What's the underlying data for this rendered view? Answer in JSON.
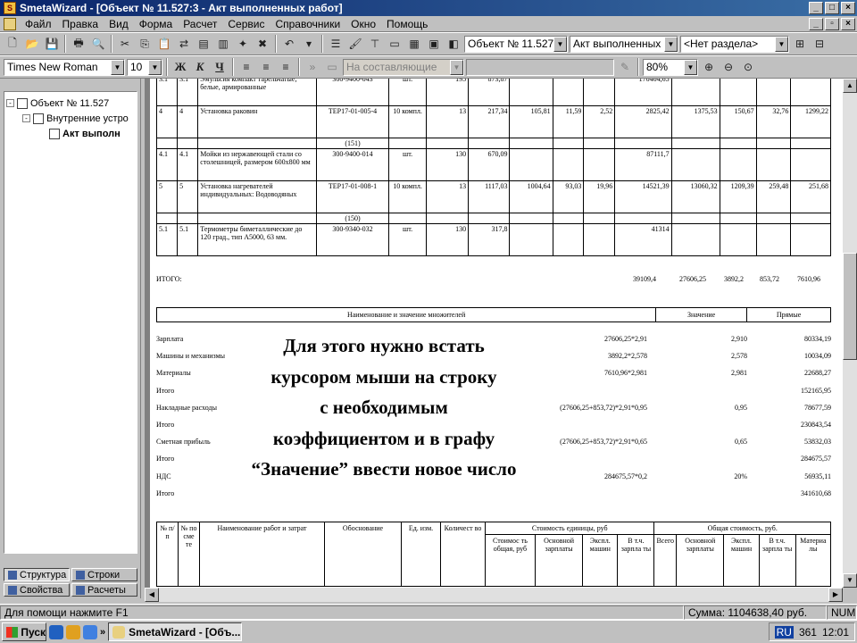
{
  "window": {
    "title": "SmetaWizard - [Объект № 11.527:3 - Акт выполненных работ]",
    "app_icon": "sw-icon"
  },
  "menu": [
    "Файл",
    "Правка",
    "Вид",
    "Форма",
    "Расчет",
    "Сервис",
    "Справочники",
    "Окно",
    "Помощь"
  ],
  "toolbar": {
    "object_combo": "Объект № 11.527",
    "form_combo": "Акт выполненных ра",
    "section_combo": "<Нет раздела>"
  },
  "format_bar": {
    "font": "Times New Roman",
    "size": "10",
    "bold": "Ж",
    "italic": "К",
    "underline": "Ч",
    "mode_combo": "На составляющие",
    "zoom": "80%"
  },
  "tree": [
    {
      "label": "Объект № 11.527",
      "expander": "-"
    },
    {
      "label": "Внутренние устро",
      "expander": "-"
    },
    {
      "label": "Акт выполн",
      "expander": ""
    }
  ],
  "tabs": {
    "structure": "Структура",
    "rows": "Строки",
    "properties": "Свойства",
    "calculations": "Расчеты"
  },
  "table_rows": [
    {
      "n": "3.1",
      "nn": "3.1",
      "name": "Эмульсия компакт тарельчатые, белые, армированные",
      "code": "300-9400-043",
      "unit": "шт.",
      "qty": "195",
      "price": "873,87",
      "c1": "",
      "c2": "",
      "c3": "",
      "total": "170404,65",
      "t1": "",
      "t2": "",
      "t3": "",
      "t4": ""
    },
    {
      "n": "4",
      "nn": "4",
      "name": "Установка раковин",
      "code": "ТЕР17-01-005-4",
      "unit": "10 компл.",
      "qty": "13",
      "price": "217,34",
      "c1": "105,81",
      "c2": "11,59",
      "c3": "2,52",
      "total": "2825,42",
      "t1": "1375,53",
      "t2": "150,67",
      "t3": "32,76",
      "t4": "1299,22"
    },
    {
      "n": "",
      "nn": "",
      "name": "",
      "code": "(151)",
      "unit": "",
      "qty": "",
      "price": "",
      "c1": "",
      "c2": "",
      "c3": "",
      "total": "",
      "t1": "",
      "t2": "",
      "t3": "",
      "t4": ""
    },
    {
      "n": "4.1",
      "nn": "4.1",
      "name": "Мойки из нержавеющей стали со столешницей, размером 600x800 мм",
      "code": "300-9400-014",
      "unit": "шт.",
      "qty": "130",
      "price": "670,09",
      "c1": "",
      "c2": "",
      "c3": "",
      "total": "87111,7",
      "t1": "",
      "t2": "",
      "t3": "",
      "t4": ""
    },
    {
      "n": "5",
      "nn": "5",
      "name": "Установка нагревателей индивидуальных: Водоводяных",
      "code": "ТЕР17-01-008-1",
      "unit": "10 компл.",
      "qty": "13",
      "price": "1117,03",
      "c1": "1004,64",
      "c2": "93,03",
      "c3": "19,96",
      "total": "14521,39",
      "t1": "13060,32",
      "t2": "1209,39",
      "t3": "259,48",
      "t4": "251,68"
    },
    {
      "n": "",
      "nn": "",
      "name": "",
      "code": "(150)",
      "unit": "",
      "qty": "",
      "price": "",
      "c1": "",
      "c2": "",
      "c3": "",
      "total": "",
      "t1": "",
      "t2": "",
      "t3": "",
      "t4": ""
    },
    {
      "n": "5.1",
      "nn": "5.1",
      "name": "Термометры биметаллические до 120 град., тип A5000, 63 мм.",
      "code": "300-9340-032",
      "unit": "шт.",
      "qty": "130",
      "price": "317,8",
      "c1": "",
      "c2": "",
      "c3": "",
      "total": "41314",
      "t1": "",
      "t2": "",
      "t3": "",
      "t4": ""
    }
  ],
  "itogo": {
    "label": "ИТОГО:",
    "total": "39109,4",
    "t1": "27606,25",
    "t2": "3892,2",
    "t3": "853,72",
    "t4": "7610,96"
  },
  "multipliers_header": {
    "name": "Наименование и значение множителей",
    "value": "Значение",
    "direct": "Прямые"
  },
  "multipliers": [
    {
      "name": "Зарплата",
      "formula": "27606,25*2,91",
      "value": "2,910",
      "direct": "80334,19"
    },
    {
      "name": "Машины и механизмы",
      "formula": "3892,2*2,578",
      "value": "2,578",
      "direct": "10034,09"
    },
    {
      "name": "Материалы",
      "formula": "7610,96*2,981",
      "value": "2,981",
      "direct": "22688,27"
    },
    {
      "name": "Итого",
      "formula": "",
      "value": "",
      "direct": "152165,95"
    },
    {
      "name": "Накладные расходы",
      "formula": "(27606,25+853,72)*2,91*0,95",
      "value": "0,95",
      "direct": "78677,59"
    },
    {
      "name": "Итого",
      "formula": "",
      "value": "",
      "direct": "230843,54"
    },
    {
      "name": "Сметная прибыль",
      "formula": "(27606,25+853,72)*2,91*0,65",
      "value": "0,65",
      "direct": "53832,03"
    },
    {
      "name": "Итого",
      "formula": "",
      "value": "",
      "direct": "284675,57"
    },
    {
      "name": "НДС",
      "formula": "284675,57*0,2",
      "value": "20%",
      "direct": "56935,11"
    },
    {
      "name": "Итого",
      "formula": "",
      "value": "",
      "direct": "341610,68"
    }
  ],
  "header2": {
    "n": "№ п/п",
    "nn": "№ по сме те",
    "name": "Наименование работ и затрат",
    "basis": "Обоснование",
    "unit": "Ед. изм.",
    "qty": "Количест во",
    "unit_cost": "Стоимость единицы, руб",
    "total_cost": "Общая стоимость, руб.",
    "sub": [
      "Стоимос ть общая, руб",
      "Основной зарплаты",
      "Экспл. машин",
      "В т.ч. зарпла ты",
      "Всего",
      "Основной зарплаты",
      "Экспл. машин",
      "В т.ч. зарпла ты",
      "Материа лы"
    ]
  },
  "overlay_text": [
    "Для этого нужно встать",
    "курсором мыши на строку",
    "с необходимым",
    "коэффициентом и в графу",
    "“Значение” ввести новое число"
  ],
  "status": {
    "help": "Для помощи нажмите F1",
    "sum": "Сумма: 1104638,40 руб.",
    "num": "NUM"
  },
  "taskbar": {
    "start": "Пуск",
    "task": "SmetaWizard - [Объ...",
    "lang": "RU",
    "tray_num": "361",
    "clock": "12:01"
  }
}
